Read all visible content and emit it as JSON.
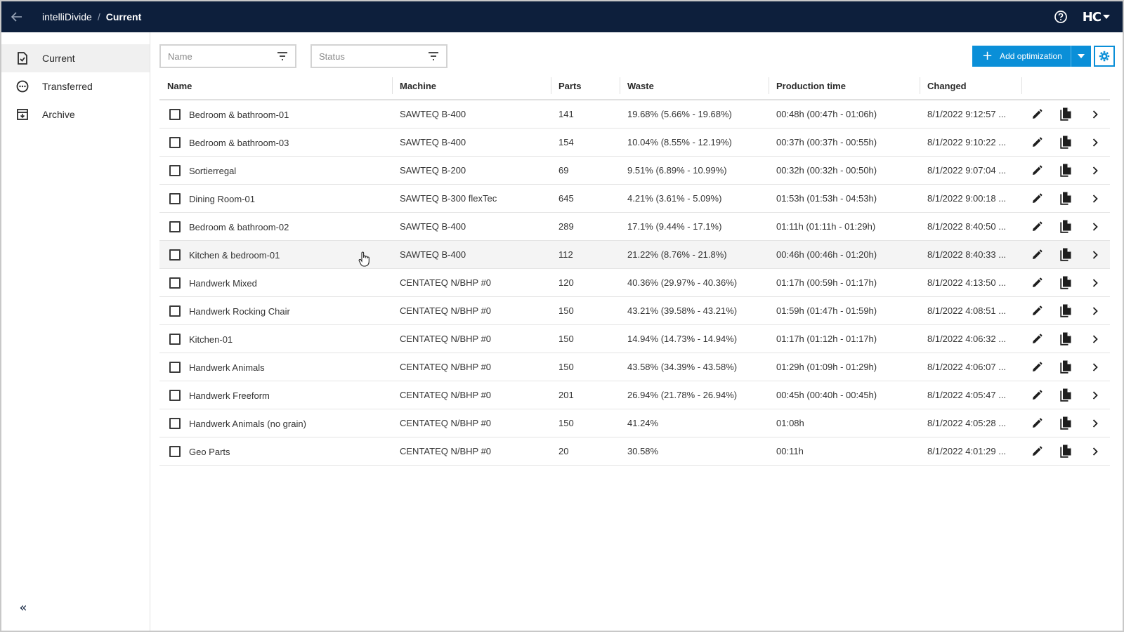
{
  "header": {
    "app_name": "intelliDivide",
    "separator": "/",
    "current_page": "Current",
    "user_logo": "HC"
  },
  "sidebar": {
    "items": [
      {
        "label": "Current",
        "icon": "document-check-icon",
        "active": true
      },
      {
        "label": "Transferred",
        "icon": "ellipsis-circle-icon",
        "active": false
      },
      {
        "label": "Archive",
        "icon": "archive-box-icon",
        "active": false
      }
    ],
    "collapse_label": "«"
  },
  "filters": {
    "name_placeholder": "Name",
    "status_placeholder": "Status"
  },
  "toolbar": {
    "add_label": "Add optimization"
  },
  "colors": {
    "topbar": "#0d1f3c",
    "accent": "#0a8fd8"
  },
  "table": {
    "columns": [
      "Name",
      "Machine",
      "Parts",
      "Waste",
      "Production time",
      "Changed"
    ],
    "rows": [
      {
        "name": "Bedroom & bathroom-01",
        "machine": "SAWTEQ B-400",
        "parts": "141",
        "waste": "19.68% (5.66% - 19.68%)",
        "time": "00:48h (00:47h - 01:06h)",
        "changed": "8/1/2022 9:12:57 ..."
      },
      {
        "name": "Bedroom & bathroom-03",
        "machine": "SAWTEQ B-400",
        "parts": "154",
        "waste": "10.04% (8.55% - 12.19%)",
        "time": "00:37h (00:37h - 00:55h)",
        "changed": "8/1/2022 9:10:22 ..."
      },
      {
        "name": "Sortierregal",
        "machine": "SAWTEQ B-200",
        "parts": "69",
        "waste": "9.51% (6.89% - 10.99%)",
        "time": "00:32h (00:32h - 00:50h)",
        "changed": "8/1/2022 9:07:04 ..."
      },
      {
        "name": "Dining Room-01",
        "machine": "SAWTEQ B-300 flexTec",
        "parts": "645",
        "waste": "4.21% (3.61% - 5.09%)",
        "time": "01:53h (01:53h - 04:53h)",
        "changed": "8/1/2022 9:00:18 ..."
      },
      {
        "name": "Bedroom & bathroom-02",
        "machine": "SAWTEQ B-400",
        "parts": "289",
        "waste": "17.1% (9.44% - 17.1%)",
        "time": "01:11h (01:11h - 01:29h)",
        "changed": "8/1/2022 8:40:50 ..."
      },
      {
        "name": "Kitchen & bedroom-01",
        "machine": "SAWTEQ B-400",
        "parts": "112",
        "waste": "21.22% (8.76% - 21.8%)",
        "time": "00:46h (00:46h - 01:20h)",
        "changed": "8/1/2022 8:40:33 ..."
      },
      {
        "name": "Handwerk Mixed",
        "machine": "CENTATEQ N/BHP #0",
        "parts": "120",
        "waste": "40.36% (29.97% - 40.36%)",
        "time": "01:17h (00:59h - 01:17h)",
        "changed": "8/1/2022 4:13:50 ..."
      },
      {
        "name": "Handwerk Rocking Chair",
        "machine": "CENTATEQ N/BHP #0",
        "parts": "150",
        "waste": "43.21% (39.58% - 43.21%)",
        "time": "01:59h (01:47h - 01:59h)",
        "changed": "8/1/2022 4:08:51 ..."
      },
      {
        "name": "Kitchen-01",
        "machine": "CENTATEQ N/BHP #0",
        "parts": "150",
        "waste": "14.94% (14.73% - 14.94%)",
        "time": "01:17h (01:12h - 01:17h)",
        "changed": "8/1/2022 4:06:32 ..."
      },
      {
        "name": "Handwerk Animals",
        "machine": "CENTATEQ N/BHP #0",
        "parts": "150",
        "waste": "43.58% (34.39% - 43.58%)",
        "time": "01:29h (01:09h - 01:29h)",
        "changed": "8/1/2022 4:06:07 ..."
      },
      {
        "name": "Handwerk Freeform",
        "machine": "CENTATEQ N/BHP #0",
        "parts": "201",
        "waste": "26.94% (21.78% - 26.94%)",
        "time": "00:45h (00:40h - 00:45h)",
        "changed": "8/1/2022 4:05:47 ..."
      },
      {
        "name": "Handwerk Animals (no grain)",
        "machine": "CENTATEQ N/BHP #0",
        "parts": "150",
        "waste": "41.24%",
        "time": "01:08h",
        "changed": "8/1/2022 4:05:28 ..."
      },
      {
        "name": "Geo Parts",
        "machine": "CENTATEQ N/BHP #0",
        "parts": "20",
        "waste": "30.58%",
        "time": "00:11h",
        "changed": "8/1/2022 4:01:29 ..."
      }
    ]
  }
}
